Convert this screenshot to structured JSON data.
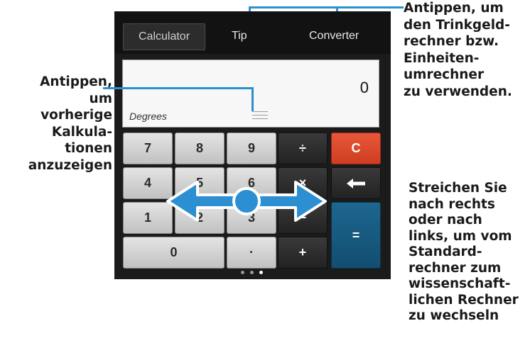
{
  "annotations": {
    "top_right": "Antippen, um\nden Trinkgeld-\nrechner bzw.\nEinheiten-\numrechner\nzu verwenden.",
    "left": "Antippen,\num\nvorherige\nKalkula-\ntionen\nanzuzeigen",
    "right": "Streichen Sie\nnach rechts\noder nach\nlinks, um vom\nStandard-\nrechner zum\nwissenschaft-\nlichen Rechner\n zu wechseln"
  },
  "tabs": {
    "calculator": "Calculator",
    "tip": "Tip",
    "converter": "Converter"
  },
  "display": {
    "value": "0",
    "mode": "Degrees"
  },
  "keys": {
    "k7": "7",
    "k8": "8",
    "k9": "9",
    "div": "÷",
    "clear": "C",
    "k4": "4",
    "k5": "5",
    "k6": "6",
    "mul": "×",
    "back": "←",
    "k1": "1",
    "k2": "2",
    "k3": "3",
    "minus": "−",
    "equals": "=",
    "k0": "0",
    "dot": "·",
    "plus": "+"
  },
  "page_indicator": {
    "pages": 3,
    "active": 3
  },
  "colors": {
    "accent": "#2b8fd1",
    "clear_key": "#de4a2c",
    "equals_key": "#1a5d85"
  },
  "icons": [
    "history-handle-icon",
    "swipe-arrow-icon",
    "backspace-icon"
  ]
}
